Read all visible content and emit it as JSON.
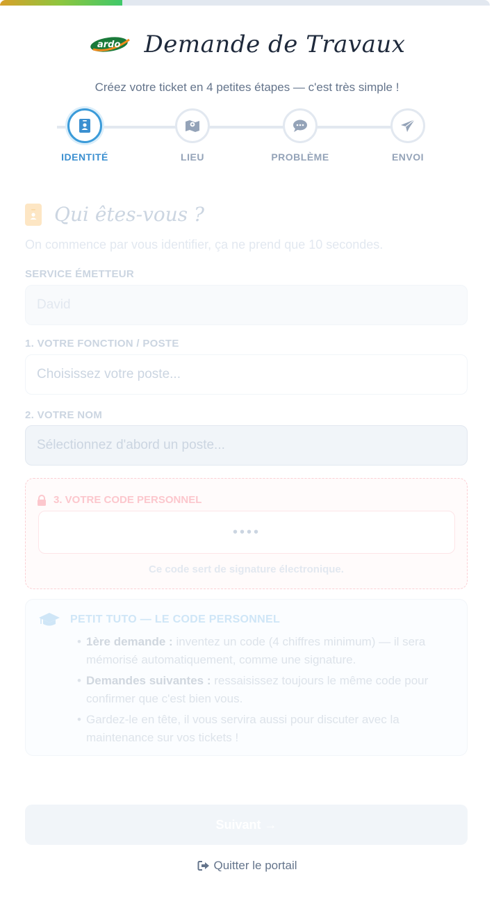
{
  "progress": {
    "percent": 25
  },
  "header": {
    "logo_text": "ardo",
    "title": "Demande de Travaux",
    "subtitle": "Créez votre ticket en 4 petites étapes — c'est très simple !"
  },
  "stepper": {
    "steps": [
      {
        "label": "IDENTITÉ",
        "icon": "id-badge-icon",
        "active": true
      },
      {
        "label": "LIEU",
        "icon": "map-icon",
        "active": false
      },
      {
        "label": "PROBLÈME",
        "icon": "comment-icon",
        "active": false
      },
      {
        "label": "ENVOI",
        "icon": "paper-plane-icon",
        "active": false
      }
    ]
  },
  "section": {
    "title": "Qui êtes-vous ?",
    "subtitle": "On commence par vous identifier, ça ne prend que 10 secondes."
  },
  "fields": {
    "service_label": "SERVICE ÉMETTEUR",
    "service_value": "David",
    "fonction_label": "1. VOTRE FONCTION / POSTE",
    "fonction_placeholder": "Choisissez votre poste...",
    "nom_label": "2. VOTRE NOM",
    "nom_placeholder": "Sélectionnez d'abord un poste..."
  },
  "code": {
    "label": "3. VOTRE CODE PERSONNEL",
    "placeholder": "••••",
    "note": "Ce code sert de signature électronique."
  },
  "tuto": {
    "title": "PETIT TUTO — LE CODE PERSONNEL",
    "items": [
      {
        "bold": "1ère demande :",
        "text": " inventez un code (4 chiffres minimum) — il sera mémorisé automatiquement, comme une signature."
      },
      {
        "bold": "Demandes suivantes :",
        "text": " ressaisissez toujours le même code pour confirmer que c'est bien vous."
      },
      {
        "bold": "",
        "text": "Gardez-le en tête, il vous servira aussi pour discuter avec la maintenance sur vos tickets !"
      }
    ]
  },
  "actions": {
    "next_label": "Suivant →",
    "quit_label": "Quitter le portail"
  },
  "colors": {
    "accent": "#3b9bd9",
    "progress_start": "#d8a02a",
    "progress_end": "#3fc86a",
    "lock": "#fcc7cd"
  }
}
